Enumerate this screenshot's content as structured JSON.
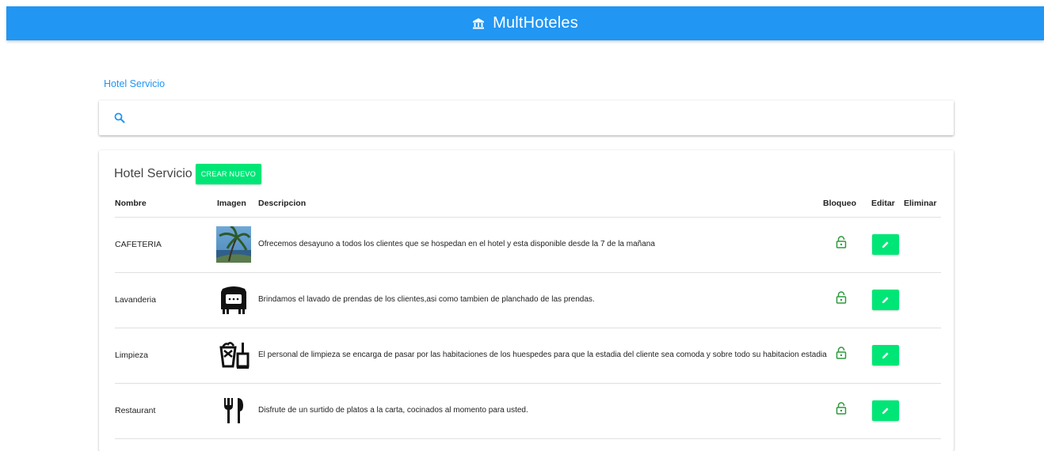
{
  "app": {
    "title": "MultHoteles",
    "accent_color": "#2196f3",
    "button_color": "#00e676"
  },
  "breadcrumb": "Hotel Servicio",
  "search": {
    "placeholder": "",
    "value": ""
  },
  "card": {
    "title": "Hotel Servicio",
    "create_label": "CREAR NUEVO"
  },
  "table": {
    "headers": {
      "nombre": "Nombre",
      "imagen": "Imagen",
      "descripcion": "Descripcion",
      "bloqueo": "Bloqueo",
      "editar": "Editar",
      "eliminar": "Eliminar"
    },
    "rows": [
      {
        "nombre": "CAFETERIA",
        "image_icon": "palm-tree-photo",
        "descripcion": "Ofrecemos desayuno a todos los clientes que se hospedan en el hotel y esta disponible desde la 7 de la mañana"
      },
      {
        "nombre": "Lavanderia",
        "image_icon": "washing-machine-icon",
        "descripcion": "Brindamos el lavado de prendas de los clientes,asi como tambien de planchado de las prendas."
      },
      {
        "nombre": "Limpieza",
        "image_icon": "cleaning-supplies-icon",
        "descripcion": "El personal de limpieza se encarga de pasar por las habitaciones de los huespedes para que la estadia del cliente sea comoda y sobre todo su habitacion estadia"
      },
      {
        "nombre": "Restaurant",
        "image_icon": "fork-knife-icon",
        "descripcion": "Disfrute de un surtido de platos a la carta, cocinados al momento para usted."
      }
    ]
  }
}
